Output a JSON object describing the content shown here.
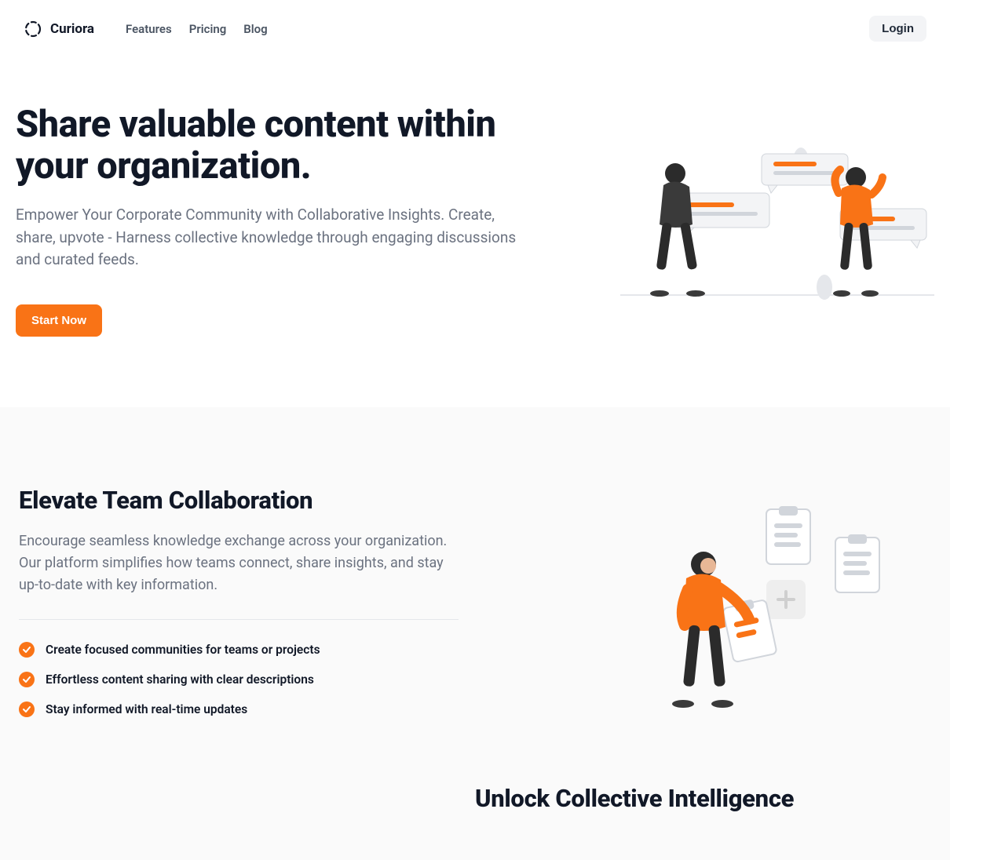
{
  "brand": {
    "name": "Curiora"
  },
  "nav": {
    "items": [
      {
        "label": "Features"
      },
      {
        "label": "Pricing"
      },
      {
        "label": "Blog"
      }
    ]
  },
  "header": {
    "login": "Login"
  },
  "hero": {
    "title": "Share valuable content within your organization.",
    "subtitle": "Empower Your Corporate Community with Collaborative Insights. Create, share, upvote - Harness collective knowledge through engaging discussions and curated feeds.",
    "cta": "Start Now"
  },
  "section2": {
    "title": "Elevate Team Collaboration",
    "description": "Encourage seamless knowledge exchange across your organization. Our platform simplifies how teams connect, share insights, and stay up-to-date with key information.",
    "bullets": [
      "Create focused communities for teams or projects",
      "Effortless content sharing with clear descriptions",
      "Stay informed with real-time updates"
    ]
  },
  "section3": {
    "title": "Unlock Collective Intelligence"
  },
  "colors": {
    "accent": "#f97316",
    "textMuted": "#6b7280"
  }
}
